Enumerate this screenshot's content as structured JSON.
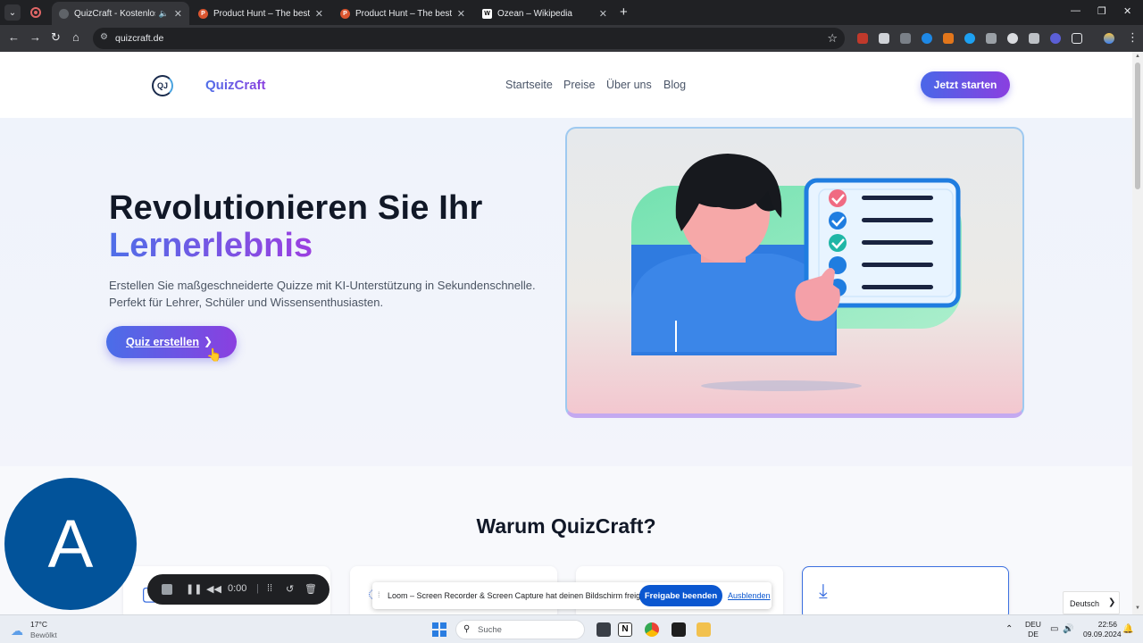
{
  "browser": {
    "tabs": [
      {
        "title": "QuizCraft - Kostenlos Quiz",
        "active": true
      },
      {
        "title": "Product Hunt – The best new p",
        "active": false
      },
      {
        "title": "Product Hunt – The best new p",
        "active": false
      },
      {
        "title": "Ozean – Wikipedia",
        "active": false
      }
    ],
    "url": "quizcraft.de"
  },
  "site": {
    "brand": "QuizCraft",
    "logo_text": "QJ",
    "nav": [
      "Startseite",
      "Preise",
      "Über uns",
      "Blog"
    ],
    "cta_top": "Jetzt starten"
  },
  "hero": {
    "line1": "Revolutionieren Sie Ihr",
    "line2": "Lernerlebnis",
    "subtitle_line1": "Erstellen Sie maßgeschneiderte Quizze mit KI-Unterstützung in Sekundenschnelle.",
    "subtitle_line2": "Perfekt für Lehrer, Schüler und Wissensenthusiasten.",
    "cta": "Quiz erstellen"
  },
  "features": {
    "title": "Warum QuizCraft?"
  },
  "overlays": {
    "avatar_letter": "A",
    "recorder_time": "0:00",
    "loom_message": "Loom – Screen Recorder & Screen Capture hat deinen Bildschirm freigegeben.",
    "loom_stop": "Freigabe beenden",
    "loom_hide": "Ausblenden",
    "language_popup": "Deutsch"
  },
  "taskbar": {
    "temperature": "17°C",
    "weather": "Bewölkt",
    "search": "Suche",
    "lang_line1": "DEU",
    "lang_line2": "DE",
    "time": "22:56",
    "date": "09.09.2024"
  },
  "colors": {
    "accent_start": "#4a67e8",
    "accent_end": "#8a3fe0",
    "browser_dark": "#202124",
    "loom_blue": "#0b57d0",
    "avatar_blue": "#02539a"
  }
}
